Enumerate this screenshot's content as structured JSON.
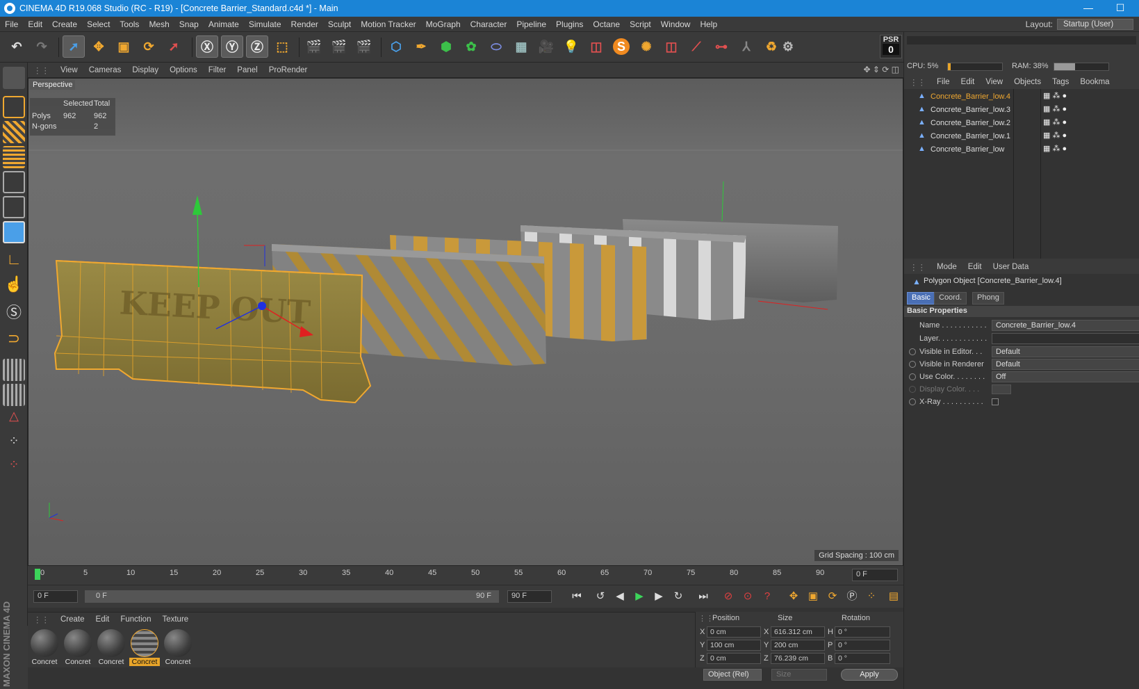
{
  "window": {
    "title": "CINEMA 4D R19.068 Studio (RC - R19) - [Concrete Barrier_Standard.c4d *] - Main",
    "minimize": "—",
    "maximize": "☐"
  },
  "menu": [
    "File",
    "Edit",
    "Create",
    "Select",
    "Tools",
    "Mesh",
    "Snap",
    "Animate",
    "Simulate",
    "Render",
    "Sculpt",
    "Motion Tracker",
    "MoGraph",
    "Character",
    "Pipeline",
    "Plugins",
    "Octane",
    "Script",
    "Window",
    "Help"
  ],
  "layout": {
    "label": "Layout:",
    "value": "Startup (User)"
  },
  "psr": {
    "label": "PSR",
    "value": "0"
  },
  "viewport": {
    "menu": [
      "View",
      "Cameras",
      "Display",
      "Options",
      "Filter",
      "Panel",
      "ProRender"
    ],
    "name": "Perspective",
    "grid_spacing": "Grid Spacing : 100 cm",
    "keep_out": "KEEP OUT"
  },
  "stats": {
    "header_selected": "Selected",
    "header_total": "Total",
    "rows": [
      {
        "label": "Polys",
        "selected": "962",
        "total": "962"
      },
      {
        "label": "N-gons",
        "selected": "",
        "total": "2"
      }
    ]
  },
  "timeline": {
    "ticks": [
      "0",
      "5",
      "10",
      "15",
      "20",
      "25",
      "30",
      "35",
      "40",
      "45",
      "50",
      "55",
      "60",
      "65",
      "70",
      "75",
      "80",
      "85",
      "90"
    ],
    "current": "0 F"
  },
  "playbar": {
    "start": "0 F",
    "range_start": "0 F",
    "range_end": "90 F",
    "end": "90 F"
  },
  "materials": {
    "menu": [
      "Create",
      "Edit",
      "Function",
      "Texture"
    ],
    "items": [
      "Concret",
      "Concret",
      "Concret",
      "Concret",
      "Concret"
    ],
    "selected_index": 3
  },
  "coords": {
    "headers": [
      "Position",
      "Size",
      "Rotation"
    ],
    "rows": [
      {
        "axis": "X",
        "pos": "0 cm",
        "sa": "X",
        "size": "616.312 cm",
        "ra": "H",
        "rot": "0 °"
      },
      {
        "axis": "Y",
        "pos": "100 cm",
        "sa": "Y",
        "size": "200 cm",
        "ra": "P",
        "rot": "0 °"
      },
      {
        "axis": "Z",
        "pos": "0 cm",
        "sa": "Z",
        "size": "76.239 cm",
        "ra": "B",
        "rot": "0 °"
      }
    ],
    "mode": "Object (Rel)",
    "size_mode": "Size",
    "apply": "Apply"
  },
  "perf": {
    "cpu": "CPU: 5%",
    "cpu_level": 0.05,
    "ram": "RAM: 38%",
    "ram_level": 0.38
  },
  "objects": {
    "menu": [
      "File",
      "Edit",
      "View",
      "Objects",
      "Tags",
      "Bookma"
    ],
    "items": [
      "Concrete_Barrier_low.4",
      "Concrete_Barrier_low.3",
      "Concrete_Barrier_low.2",
      "Concrete_Barrier_low.1",
      "Concrete_Barrier_low"
    ],
    "selected_index": 0
  },
  "attributes": {
    "menu": [
      "Mode",
      "Edit",
      "User Data"
    ],
    "object_title": "Polygon Object [Concrete_Barrier_low.4]",
    "tabs": [
      "Basic",
      "Coord.",
      "Phong"
    ],
    "section": "Basic Properties",
    "props": [
      {
        "label": "Name . . . . . . . . . . .",
        "value": "Concrete_Barrier_low.4"
      },
      {
        "label": "Layer. . . . . . . . . . . .",
        "value": ""
      },
      {
        "label": "Visible in Editor. . .",
        "value": "Default"
      },
      {
        "label": "Visible in Renderer",
        "value": "Default"
      },
      {
        "label": "Use Color. . . . . . . .",
        "value": "Off"
      },
      {
        "label": "Display Color. . . .",
        "value": ""
      },
      {
        "label": "X-Ray . . . . . . . . . .",
        "value": ""
      }
    ]
  },
  "brand": "MAXON CINEMA 4D",
  "colors": {
    "accent": "#e8a52a",
    "title_blue": "#1b84d6",
    "selection_orange": "#f0a830"
  }
}
